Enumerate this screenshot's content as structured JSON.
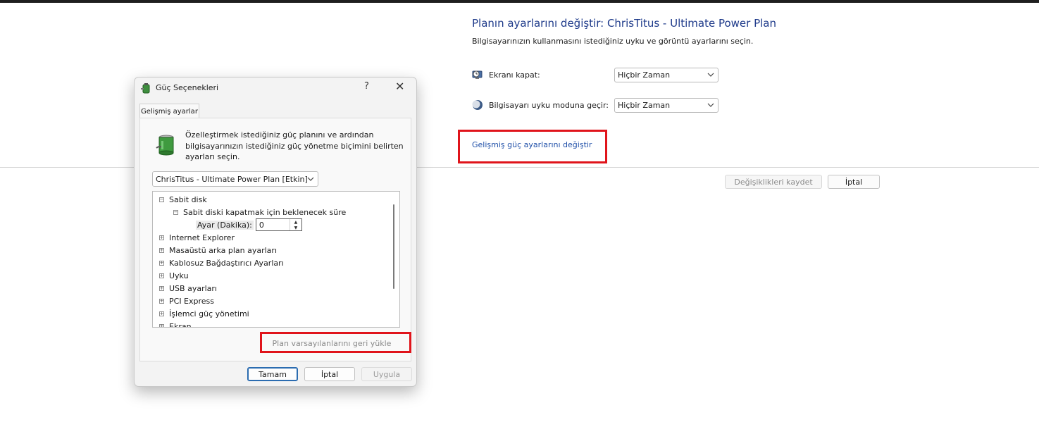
{
  "plan_settings": {
    "title": "Planın ayarlarını değiştir: ChrisTitus - Ultimate Power Plan",
    "subtitle": "Bilgisayarınızın kullanmasını istediğiniz uyku ve görüntü ayarlarını seçin.",
    "display_off_label": "Ekranı kapat:",
    "display_off_value": "Hiçbir Zaman",
    "sleep_label": "Bilgisayarı uyku moduna geçir:",
    "sleep_value": "Hiçbir Zaman",
    "advanced_link": "Gelişmiş güç ayarlarını değiştir",
    "save_button": "Değişiklikleri kaydet",
    "cancel_button": "İptal"
  },
  "dialog": {
    "title": "Güç Seçenekleri",
    "help": "?",
    "close": "✕",
    "tab": "Gelişmiş ayarlar",
    "description": "Özelleştirmek istediğiniz güç planını ve ardından bilgisayarınızın istediğiniz güç yönetme biçimini belirten ayarları seçin.",
    "plan_select": "ChrisTitus - Ultimate Power Plan [Etkin]",
    "tree": {
      "hard_disk": "Sabit disk",
      "turn_off_after": "Sabit diski kapatmak için beklenecek süre",
      "setting_label": "Ayar (Dakika):",
      "setting_value": "0",
      "items": [
        "Internet Explorer",
        "Masaüstü arka plan ayarları",
        "Kablosuz Bağdaştırıcı Ayarları",
        "Uyku",
        "USB ayarları",
        "PCI Express",
        "İşlemci güç yönetimi",
        "Ekran"
      ]
    },
    "restore_button": "Plan varsayılanlarını geri yükle",
    "ok_button": "Tamam",
    "cancel_button": "İptal",
    "apply_button": "Uygula"
  },
  "colors": {
    "highlight_box": "#e0141b",
    "link": "#1f4fa8",
    "title": "#1e3a8a"
  },
  "icons": [
    "clock-monitor-icon",
    "moon-icon",
    "battery-plug-icon",
    "chevron-down-icon",
    "close-icon",
    "help-icon",
    "expand-icon",
    "collapse-icon"
  ]
}
